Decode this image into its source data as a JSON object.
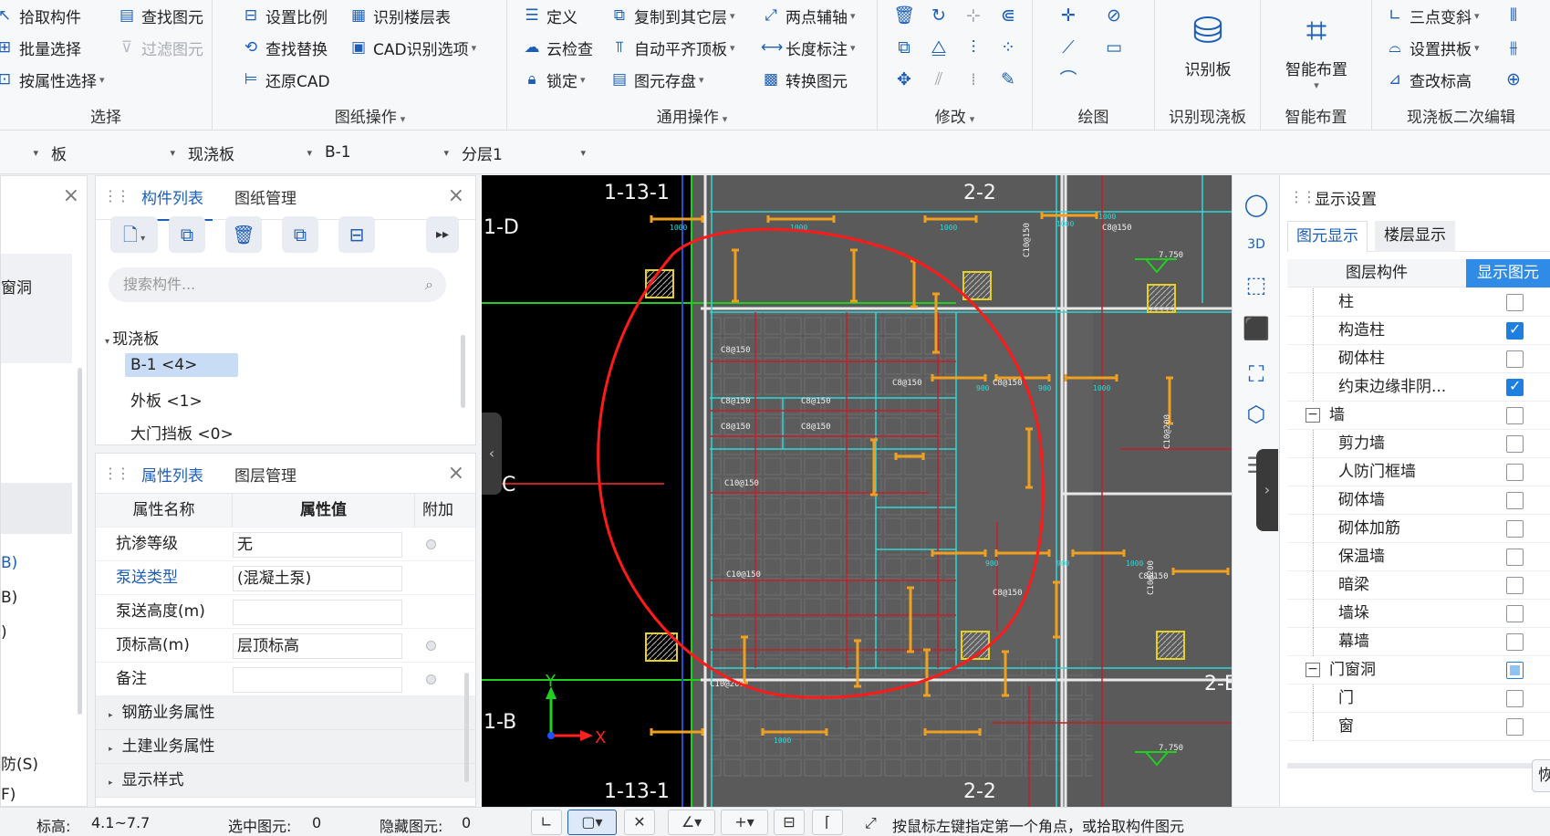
{
  "ribbon": {
    "select_group": {
      "items": [
        {
          "label": "拾取构件",
          "icon": "pick-icon"
        },
        {
          "label": "批量选择",
          "icon": "batch-select-icon"
        },
        {
          "label": "按属性选择",
          "icon": "select-by-property-icon"
        },
        {
          "label": "查找图元",
          "icon": "find-element-icon"
        },
        {
          "label": "过滤图元",
          "icon": "filter-icon"
        }
      ],
      "label": "选择"
    },
    "drawing_group": {
      "items": [
        {
          "label": "设置比例",
          "icon": "scale-icon"
        },
        {
          "label": "查找替换",
          "icon": "find-replace-icon"
        },
        {
          "label": "还原CAD",
          "icon": "restore-cad-icon"
        },
        {
          "label": "识别楼层表",
          "icon": "floor-table-icon"
        },
        {
          "label": "CAD识别选项",
          "icon": "cad-options-icon"
        }
      ],
      "label": "图纸操作"
    },
    "common_group": {
      "items": [
        {
          "label": "定义",
          "icon": "define-icon"
        },
        {
          "label": "云检查",
          "icon": "cloud-check-icon"
        },
        {
          "label": "锁定",
          "icon": "lock-icon"
        },
        {
          "label": "复制到其它层",
          "icon": "copy-layer-icon"
        },
        {
          "label": "自动平齐顶板",
          "icon": "align-top-icon"
        },
        {
          "label": "图元存盘",
          "icon": "save-element-icon"
        },
        {
          "label": "两点辅轴",
          "icon": "two-point-axis-icon"
        },
        {
          "label": "长度标注",
          "icon": "length-dim-icon"
        },
        {
          "label": "转换图元",
          "icon": "convert-icon"
        }
      ],
      "label": "通用操作"
    },
    "modify_group": {
      "label": "修改"
    },
    "draw_group": {
      "label": "绘图"
    },
    "recognize_group": {
      "button": "识别板",
      "label": "识别现浇板"
    },
    "smart_group": {
      "button": "智能布置",
      "label": "智能布置"
    },
    "edit2_group": {
      "items": [
        {
          "label": "三点变斜",
          "icon": "three-point-slope-icon"
        },
        {
          "label": "设置拱板",
          "icon": "arch-slab-icon"
        },
        {
          "label": "查改标高",
          "icon": "elevation-icon"
        }
      ],
      "label": "现浇板二次编辑"
    }
  },
  "selectors": {
    "category": "板",
    "type": "现浇板",
    "component": "B-1",
    "layer": "分层1"
  },
  "component_panel": {
    "tabs": [
      "构件列表",
      "图纸管理"
    ],
    "search_placeholder": "搜索构件...",
    "tree_root": "现浇板",
    "items": [
      "B-1 <4>",
      "外板 <1>",
      "大门挡板 <0>"
    ]
  },
  "left_partial": {
    "text1": "窗洞",
    "text2": "B)",
    "text3": "B)",
    "text4": ")",
    "text5": "防(S)",
    "text6": "F)"
  },
  "property_panel": {
    "tabs": [
      "属性列表",
      "图层管理"
    ],
    "headers": [
      "属性名称",
      "属性值",
      "附加"
    ],
    "rows": [
      {
        "name": "抗渗等级",
        "value": "无",
        "radio": true,
        "link": false
      },
      {
        "name": "泵送类型",
        "value": "(混凝土泵)",
        "radio": false,
        "link": true
      },
      {
        "name": "泵送高度(m)",
        "value": "",
        "radio": false,
        "link": false
      },
      {
        "name": "顶标高(m)",
        "value": "层顶标高",
        "radio": true,
        "link": false
      },
      {
        "name": "备注",
        "value": "",
        "radio": true,
        "link": false
      }
    ],
    "groups": [
      "钢筋业务属性",
      "土建业务属性",
      "显示样式"
    ]
  },
  "canvas": {
    "axis_labels": {
      "top_left": "1-13-1",
      "top_right": "2-2",
      "bottom_left": "1-13-1",
      "bottom_right": "2-2",
      "left_top": "1-D",
      "left_mid": "C",
      "left_bottom": "1-B",
      "right_bottom": "2-E"
    },
    "rebar_labels": [
      "C8@150",
      "C8@150",
      "C8@150",
      "C8@150",
      "C8@150",
      "C10@150",
      "C10@150",
      "C8@150",
      "C8@150",
      "C8@150",
      "C10@200",
      "C10@200",
      "C8@150",
      "C10@200",
      "C8@150",
      "C10@150"
    ],
    "elevation_labels": [
      "7.750",
      "7.750"
    ],
    "dim_labels": [
      "1000",
      "1000",
      "1000",
      "1000",
      "1000",
      "900",
      "900",
      "1000",
      "900",
      "900",
      "1000",
      "1000"
    ],
    "ucs": {
      "x": "X",
      "y": "Y"
    }
  },
  "display_panel": {
    "title": "显示设置",
    "tabs": [
      "图元显示",
      "楼层显示"
    ],
    "headers": [
      "图层构件",
      "显示图元"
    ],
    "rows": [
      {
        "label": "柱",
        "level": 1,
        "checked": "off",
        "expander": ""
      },
      {
        "label": "构造柱",
        "level": 1,
        "checked": "on",
        "expander": ""
      },
      {
        "label": "砌体柱",
        "level": 1,
        "checked": "off",
        "expander": ""
      },
      {
        "label": "约束边缘非阴...",
        "level": 1,
        "checked": "on",
        "expander": ""
      },
      {
        "label": "墙",
        "level": 0,
        "checked": "off",
        "expander": "−"
      },
      {
        "label": "剪力墙",
        "level": 1,
        "checked": "off",
        "expander": ""
      },
      {
        "label": "人防门框墙",
        "level": 1,
        "checked": "off",
        "expander": ""
      },
      {
        "label": "砌体墙",
        "level": 1,
        "checked": "off",
        "expander": ""
      },
      {
        "label": "砌体加筋",
        "level": 1,
        "checked": "off",
        "expander": ""
      },
      {
        "label": "保温墙",
        "level": 1,
        "checked": "off",
        "expander": ""
      },
      {
        "label": "暗梁",
        "level": 1,
        "checked": "off",
        "expander": ""
      },
      {
        "label": "墙垛",
        "level": 1,
        "checked": "off",
        "expander": ""
      },
      {
        "label": "幕墙",
        "level": 1,
        "checked": "off",
        "expander": ""
      },
      {
        "label": "门窗洞",
        "level": 0,
        "checked": "half",
        "expander": "−"
      },
      {
        "label": "门",
        "level": 1,
        "checked": "off",
        "expander": ""
      },
      {
        "label": "窗",
        "level": 1,
        "checked": "off",
        "expander": ""
      }
    ],
    "bottom_btn": "恢"
  },
  "status": {
    "elevation_label": "标高:",
    "elevation_value": "4.1~7.7",
    "selected_label": "选中图元:",
    "selected_value": "0",
    "hidden_label": "隐藏图元:",
    "hidden_value": "0",
    "hint": "按鼠标左键指定第一个角点，或拾取构件图元"
  },
  "colors": {
    "accent": "#1d5fb8",
    "canvas_bg": "#000000",
    "slab_fill": "#5a5a5a",
    "axis_green": "#20d020",
    "rebar_orange": "#f0a020",
    "annotation_red": "#ff1a1a",
    "beam_cyan": "#30d8d8"
  }
}
